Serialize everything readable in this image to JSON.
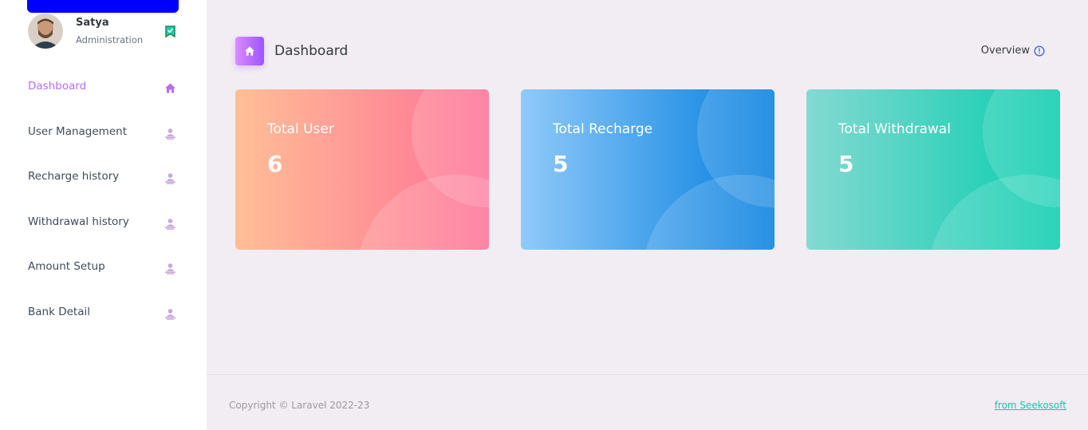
{
  "profile": {
    "name": "Satya",
    "role": "Administration"
  },
  "sidebar": {
    "items": [
      {
        "label": "Dashboard",
        "icon": "home-icon",
        "active": true
      },
      {
        "label": "User Management",
        "icon": "user-icon"
      },
      {
        "label": "Recharge history",
        "icon": "user-icon"
      },
      {
        "label": "Withdrawal history",
        "icon": "user-icon"
      },
      {
        "label": "Amount Setup",
        "icon": "user-icon"
      },
      {
        "label": "Bank Detail",
        "icon": "user-icon"
      }
    ]
  },
  "header": {
    "title": "Dashboard",
    "overview_label": "Overview"
  },
  "cards": [
    {
      "title": "Total User",
      "value": "6"
    },
    {
      "title": "Total Recharge",
      "value": "5"
    },
    {
      "title": "Total Withdrawal",
      "value": "5"
    }
  ],
  "footer": {
    "copyright": "Copyright © Laravel 2022-23",
    "credit": "from Seekosoft"
  },
  "colors": {
    "accent": "#b66dff",
    "brand_bar": "#0000ff",
    "credit_link": "#07cdae"
  }
}
